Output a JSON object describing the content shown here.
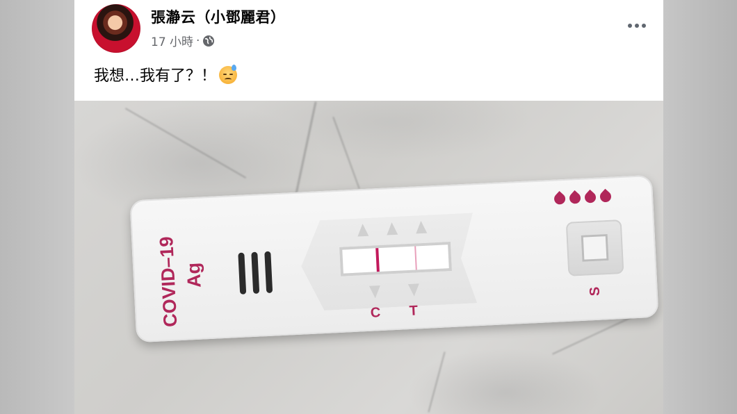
{
  "post": {
    "author": "張瀞云（小鄧麗君）",
    "time": "17 小時",
    "separator": "·",
    "text": "我想…我有了？！",
    "emoji": "downcast-face-with-sweat",
    "privacy_icon": "globe-icon",
    "more_icon": "more-options-icon"
  },
  "photo": {
    "device_label_line1": "COVID–19",
    "device_label_line2": "Ag",
    "control_letter": "C",
    "test_letter": "T",
    "sample_letter": "S",
    "colors": {
      "accent": "#b0275a",
      "control_line": "#c2185b",
      "test_line": "#e8a0bb"
    }
  }
}
